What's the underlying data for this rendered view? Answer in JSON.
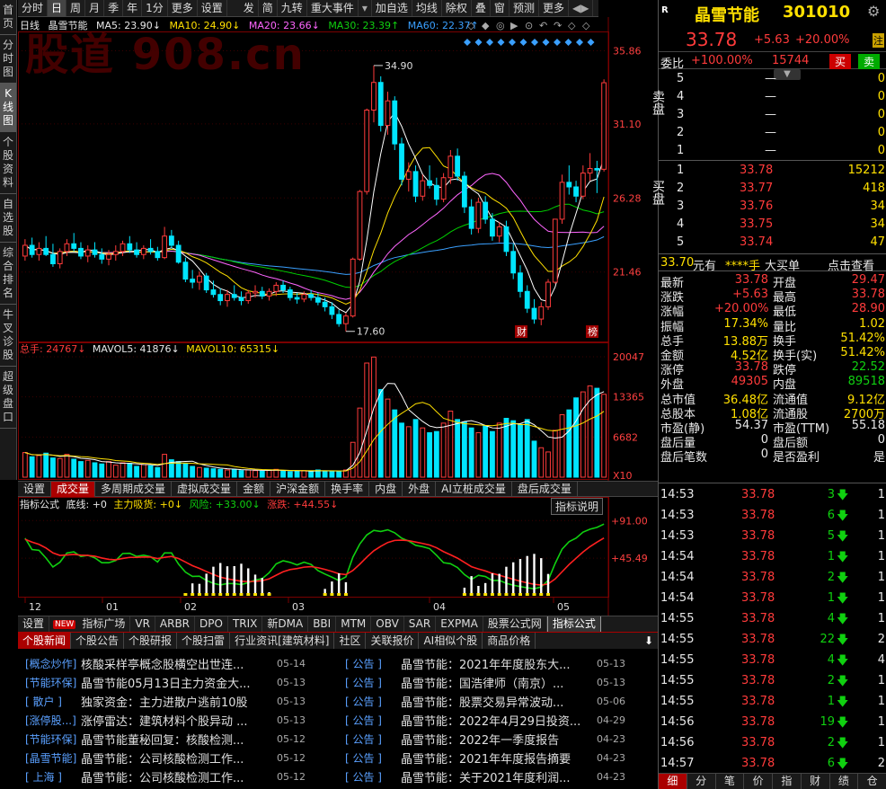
{
  "left_tabs": [
    "首页",
    "分时图",
    "K线图",
    "个股资料",
    "自选股",
    "综合排名",
    "牛叉诊股",
    "超级盘口"
  ],
  "left_tabs_active": 2,
  "toolbar": [
    "分时",
    "日",
    "周",
    "月",
    "季",
    "年",
    "1分",
    "更多",
    "设置",
    "发",
    "简",
    "九转",
    "重大事件",
    "加自选",
    "均线",
    "除权",
    "叠",
    "窗",
    "预测",
    "更多"
  ],
  "toolbar_active": 1,
  "toolbar_dropdown": "▾",
  "toolbar_nav": "◀▶",
  "watermark": "股道 908.cn",
  "chart_header": {
    "period": "日线",
    "name": "晶雪节能",
    "ma5": "MA5: 23.90↓",
    "ma10": "MA10: 24.90↓",
    "ma20": "MA20: 23.66↓",
    "ma30": "MA30: 23.39↑",
    "ma60": "MA60: 22.37↑"
  },
  "price_axis": [
    "35.86",
    "31.10",
    "26.28",
    "21.46"
  ],
  "high_label": "34.90",
  "low_label": "17.60",
  "markers": {
    "cai": "财",
    "bang": "榜"
  },
  "vol_header": {
    "total": "总手: 24767↓",
    "mavol5": "MAVOL5: 41876↓",
    "mavol10": "MAVOL10: 65315↓"
  },
  "vol_axis": [
    "20047",
    "13365",
    "6682",
    "X10"
  ],
  "sub_tabs": [
    "设置",
    "成交量",
    "多周期成交量",
    "虚拟成交量",
    "金额",
    "沪深金额",
    "换手率",
    "内盘",
    "外盘",
    "AI立桩成交量",
    "盘后成交量"
  ],
  "sub_tabs_active": 1,
  "ind_header": {
    "name": "指标公式",
    "base": "底线: +0",
    "main": "主力吸货: +0↓",
    "risk": "风险: +33.00↓",
    "rise": "涨跌: +44.55↓"
  },
  "ind_explain": "指标说明",
  "ind_axis": [
    "+91.00",
    "+45.49"
  ],
  "date_axis": [
    "12",
    "01",
    "02",
    "03",
    "04",
    "05"
  ],
  "formula_tabs": [
    "设置",
    "NEW",
    "指标广场",
    "VR",
    "ARBR",
    "DPO",
    "TRIX",
    "新DMA",
    "BBI",
    "MTM",
    "OBV",
    "SAR",
    "EXPMA",
    "股票公式网",
    "指标公式"
  ],
  "formula_active": 14,
  "news_tabs": [
    "个股新闻",
    "个股公告",
    "个股研报",
    "个股扫雷",
    "行业资讯[建筑材料]",
    "社区",
    "关联报价",
    "AI相似个股",
    "商品价格"
  ],
  "news_tabs_active": 0,
  "news_download": "⬇",
  "news_left": [
    {
      "tag": "[概念炒作]",
      "title": "核酸采样亭概念股横空出世连...",
      "date": "05-14"
    },
    {
      "tag": "[节能环保]",
      "title": "晶雪节能05月13日主力资金大...",
      "date": "05-13"
    },
    {
      "tag": "[ 散户 ]",
      "title": "独家资金：主力进散户逃前10股",
      "date": "05-13"
    },
    {
      "tag": "[涨停股...]",
      "title": "涨停雷达：建筑材料个股异动 ...",
      "date": "05-13"
    },
    {
      "tag": "[节能环保]",
      "title": "晶雪节能董秘回复：核酸检测...",
      "date": "05-12"
    },
    {
      "tag": "[晶雪节能]",
      "title": "晶雪节能：公司核酸检测工作...",
      "date": "05-12"
    },
    {
      "tag": "[ 上海 ]",
      "title": "晶雪节能：公司核酸检测工作...",
      "date": "05-12"
    }
  ],
  "news_right": [
    {
      "tag": "[ 公告 ]",
      "title": "晶雪节能：2021年年度股东大...",
      "date": "05-13"
    },
    {
      "tag": "[ 公告 ]",
      "title": "晶雪节能：国浩律师（南京）...",
      "date": "05-13"
    },
    {
      "tag": "[ 公告 ]",
      "title": "晶雪节能：股票交易异常波动...",
      "date": "05-06"
    },
    {
      "tag": "[ 公告 ]",
      "title": "晶雪节能：2022年4月29日投资...",
      "date": "04-29"
    },
    {
      "tag": "[ 公告 ]",
      "title": "晶雪节能：2022年一季度报告",
      "date": "04-23"
    },
    {
      "tag": "[ 公告 ]",
      "title": "晶雪节能：2021年年度报告摘要",
      "date": "04-23"
    },
    {
      "tag": "[ 公告 ]",
      "title": "晶雪节能：关于2021年度利润...",
      "date": "04-23"
    }
  ],
  "stock": {
    "badge": "R",
    "name": "晶雪节能",
    "code": "301010",
    "price": "33.78",
    "change": "+5.63",
    "pct": "+20.00%",
    "zhu": "注",
    "gear": "⚙"
  },
  "weibi": {
    "label": "委比",
    "value": "+100.00%",
    "diff": "15744",
    "buy": "买",
    "sell": "卖"
  },
  "sell_orders": [
    [
      "5",
      "—",
      "0"
    ],
    [
      "4",
      "—",
      "0"
    ],
    [
      "3",
      "—",
      "0"
    ],
    [
      "2",
      "—",
      "0"
    ],
    [
      "1",
      "—",
      "0"
    ]
  ],
  "buy_orders": [
    [
      "1",
      "33.78",
      "15212"
    ],
    [
      "2",
      "33.77",
      "418"
    ],
    [
      "3",
      "33.76",
      "34"
    ],
    [
      "4",
      "33.75",
      "34"
    ],
    [
      "5",
      "33.74",
      "47"
    ]
  ],
  "sell_label": "卖盘",
  "buy_label": "买盘",
  "big_order": {
    "price": "33.70",
    "unit": "元有",
    "hands": "****手",
    "label": "大买单",
    "link": "点击查看"
  },
  "stats": [
    [
      "最新",
      "33.78",
      "开盘",
      "29.47"
    ],
    [
      "涨跌",
      "+5.63",
      "最高",
      "33.78"
    ],
    [
      "涨幅",
      "+20.00%",
      "最低",
      "28.90"
    ],
    [
      "振幅",
      "17.34%",
      "量比",
      "1.02"
    ],
    [
      "总手",
      "13.88万",
      "换手",
      "51.42%"
    ],
    [
      "金额",
      "4.52亿",
      "换手(实)",
      "51.42%"
    ],
    [
      "涨停",
      "33.78",
      "跌停",
      "22.52"
    ],
    [
      "外盘",
      "49305",
      "内盘",
      "89518"
    ],
    [
      "总市值",
      "36.48亿",
      "流通值",
      "9.12亿"
    ],
    [
      "总股本",
      "1.08亿",
      "流通股",
      "2700万"
    ],
    [
      "市盈(静)",
      "54.37",
      "市盈(TTM)",
      "55.18"
    ],
    [
      "盘后量",
      "0",
      "盘后额",
      "0"
    ],
    [
      "盘后笔数",
      "0",
      "是否盈利",
      "是"
    ]
  ],
  "ticks": [
    [
      "14:53",
      "33.78",
      "3",
      "1"
    ],
    [
      "14:53",
      "33.78",
      "6",
      "1"
    ],
    [
      "14:53",
      "33.78",
      "5",
      "1"
    ],
    [
      "14:54",
      "33.78",
      "1",
      "1"
    ],
    [
      "14:54",
      "33.78",
      "2",
      "1"
    ],
    [
      "14:54",
      "33.78",
      "1",
      "1"
    ],
    [
      "14:55",
      "33.78",
      "4",
      "1"
    ],
    [
      "14:55",
      "33.78",
      "22",
      "2"
    ],
    [
      "14:55",
      "33.78",
      "4",
      "4"
    ],
    [
      "14:55",
      "33.78",
      "2",
      "1"
    ],
    [
      "14:55",
      "33.78",
      "1",
      "1"
    ],
    [
      "14:56",
      "33.78",
      "19",
      "1"
    ],
    [
      "14:56",
      "33.78",
      "2",
      "1"
    ],
    [
      "14:57",
      "33.78",
      "6",
      "2"
    ]
  ],
  "bottom_tabs": [
    "细",
    "分",
    "笔",
    "价",
    "指",
    "财",
    "绩",
    "仓"
  ],
  "bottom_tabs_active": 0,
  "colors": {
    "up": "#ff3b3b",
    "down": "#00e5ff",
    "ma5": "#ffffff",
    "ma10": "#ffe000",
    "ma20": "#ff66ff",
    "ma30": "#00d000",
    "ma60": "#3aa0ff"
  },
  "chart_data": {
    "type": "candlestick",
    "ylim": [
      17,
      37
    ],
    "candles": [
      [
        22.5,
        23.6,
        22.2,
        23.2
      ],
      [
        23.2,
        23.7,
        22.4,
        22.6
      ],
      [
        22.6,
        23.4,
        22.2,
        23.0
      ],
      [
        23.0,
        23.8,
        22.5,
        22.6
      ],
      [
        22.6,
        23.3,
        21.8,
        22.0
      ],
      [
        22.0,
        23.0,
        21.7,
        22.8
      ],
      [
        22.8,
        23.6,
        22.5,
        23.3
      ],
      [
        23.3,
        24.0,
        22.8,
        23.0
      ],
      [
        23.0,
        23.4,
        22.3,
        22.5
      ],
      [
        22.5,
        23.2,
        22.1,
        22.9
      ],
      [
        22.9,
        23.4,
        22.4,
        22.6
      ],
      [
        22.6,
        23.0,
        22.0,
        22.3
      ],
      [
        22.3,
        22.9,
        21.9,
        22.6
      ],
      [
        22.6,
        23.2,
        22.2,
        22.8
      ],
      [
        22.8,
        23.5,
        22.5,
        23.3
      ],
      [
        23.3,
        23.8,
        22.7,
        22.9
      ],
      [
        22.9,
        23.4,
        22.4,
        22.6
      ],
      [
        22.6,
        23.2,
        22.3,
        23.0
      ],
      [
        23.0,
        23.6,
        22.6,
        22.8
      ],
      [
        22.8,
        23.1,
        22.2,
        22.4
      ],
      [
        22.4,
        24.4,
        22.3,
        23.8
      ],
      [
        23.8,
        24.2,
        23.0,
        23.2
      ],
      [
        23.2,
        23.5,
        22.0,
        22.1
      ],
      [
        22.1,
        22.4,
        20.8,
        21.0
      ],
      [
        21.0,
        21.6,
        20.4,
        20.8
      ],
      [
        20.8,
        21.5,
        20.3,
        21.2
      ],
      [
        21.2,
        21.4,
        20.1,
        20.3
      ],
      [
        20.3,
        20.9,
        19.8,
        20.0
      ],
      [
        20.0,
        20.4,
        19.3,
        19.6
      ],
      [
        19.6,
        20.3,
        19.2,
        20.0
      ],
      [
        20.0,
        20.6,
        19.6,
        19.8
      ],
      [
        19.8,
        20.2,
        19.3,
        19.6
      ],
      [
        19.6,
        20.3,
        19.4,
        20.1
      ],
      [
        20.1,
        20.6,
        19.8,
        20.2
      ],
      [
        20.2,
        20.5,
        19.7,
        19.9
      ],
      [
        19.9,
        20.4,
        19.6,
        20.2
      ],
      [
        20.2,
        20.8,
        19.9,
        20.6
      ],
      [
        20.6,
        20.9,
        20.1,
        20.3
      ],
      [
        20.3,
        20.5,
        19.6,
        19.8
      ],
      [
        19.8,
        20.1,
        19.4,
        19.7
      ],
      [
        19.7,
        20.2,
        19.5,
        20.0
      ],
      [
        20.0,
        20.3,
        19.6,
        19.8
      ],
      [
        19.8,
        20.1,
        19.3,
        19.5
      ],
      [
        19.5,
        19.8,
        18.9,
        19.2
      ],
      [
        19.2,
        19.5,
        18.4,
        18.7
      ],
      [
        18.7,
        19.0,
        17.9,
        18.1
      ],
      [
        18.1,
        18.8,
        17.6,
        18.6
      ],
      [
        18.6,
        22.4,
        18.5,
        22.3
      ],
      [
        22.3,
        26.8,
        22.2,
        26.7
      ],
      [
        26.7,
        32.1,
        26.5,
        32.0
      ],
      [
        32.0,
        34.9,
        31.2,
        33.8
      ],
      [
        33.8,
        34.2,
        30.6,
        31.0
      ],
      [
        31.0,
        33.2,
        30.4,
        32.6
      ],
      [
        32.6,
        32.9,
        29.4,
        29.8
      ],
      [
        29.8,
        30.2,
        27.1,
        27.5
      ],
      [
        27.5,
        28.6,
        26.7,
        28.0
      ],
      [
        28.0,
        28.4,
        26.0,
        26.4
      ],
      [
        26.4,
        27.8,
        26.1,
        27.4
      ],
      [
        27.4,
        28.4,
        26.9,
        27.1
      ],
      [
        27.1,
        27.6,
        25.8,
        26.2
      ],
      [
        26.2,
        27.9,
        26.0,
        27.6
      ],
      [
        27.6,
        29.4,
        27.2,
        29.0
      ],
      [
        29.0,
        29.5,
        27.4,
        27.7
      ],
      [
        27.7,
        28.0,
        25.3,
        25.7
      ],
      [
        25.7,
        26.2,
        23.9,
        24.3
      ],
      [
        24.3,
        26.3,
        24.0,
        26.0
      ],
      [
        26.0,
        26.4,
        24.6,
        24.9
      ],
      [
        24.9,
        25.3,
        23.5,
        23.8
      ],
      [
        23.8,
        24.7,
        23.4,
        24.4
      ],
      [
        24.4,
        24.8,
        22.5,
        22.8
      ],
      [
        22.8,
        23.3,
        21.0,
        21.4
      ],
      [
        21.4,
        21.9,
        19.8,
        20.2
      ],
      [
        20.2,
        20.6,
        18.8,
        19.1
      ],
      [
        19.1,
        19.7,
        18.1,
        18.4
      ],
      [
        18.4,
        19.5,
        18.0,
        19.2
      ],
      [
        19.2,
        21.0,
        19.0,
        20.8
      ],
      [
        20.8,
        24.9,
        20.7,
        24.9
      ],
      [
        24.9,
        27.8,
        24.6,
        27.3
      ],
      [
        27.3,
        28.4,
        26.5,
        27.0
      ],
      [
        27.0,
        27.4,
        26.0,
        26.4
      ],
      [
        26.4,
        28.4,
        26.2,
        27.9
      ],
      [
        27.9,
        29.2,
        27.4,
        28.2
      ],
      [
        28.2,
        28.7,
        26.6,
        28.1
      ],
      [
        28.15,
        34.0,
        28.0,
        33.78
      ]
    ],
    "volume": [
      4.1,
      3.4,
      3.6,
      4.0,
      3.2,
      3.1,
      3.8,
      3.0,
      2.6,
      2.8,
      2.4,
      2.2,
      2.6,
      2.0,
      2.4,
      2.3,
      1.8,
      2.1,
      1.9,
      1.6,
      3.8,
      2.9,
      2.6,
      2.2,
      1.8,
      1.6,
      1.5,
      1.4,
      1.3,
      1.2,
      1.3,
      1.1,
      1.2,
      1.1,
      1.0,
      1.2,
      1.3,
      1.0,
      0.9,
      1.0,
      1.1,
      1.0,
      1.2,
      1.0,
      0.9,
      1.0,
      1.2,
      5.8,
      11.5,
      19.0,
      20.0,
      14.6,
      13.0,
      11.2,
      9.0,
      8.4,
      9.6,
      8.2,
      7.4,
      7.6,
      9.0,
      11.0,
      9.6,
      9.2,
      8.2,
      7.4,
      8.6,
      7.6,
      9.0,
      9.8,
      9.4,
      8.8,
      9.6,
      6.0,
      4.9,
      4.2,
      7.8,
      10.4,
      11.2,
      13.2,
      14.2,
      15.2,
      14.8,
      13.8
    ],
    "volume_unit": "X10",
    "ylim_volume": [
      0,
      20047
    ]
  }
}
